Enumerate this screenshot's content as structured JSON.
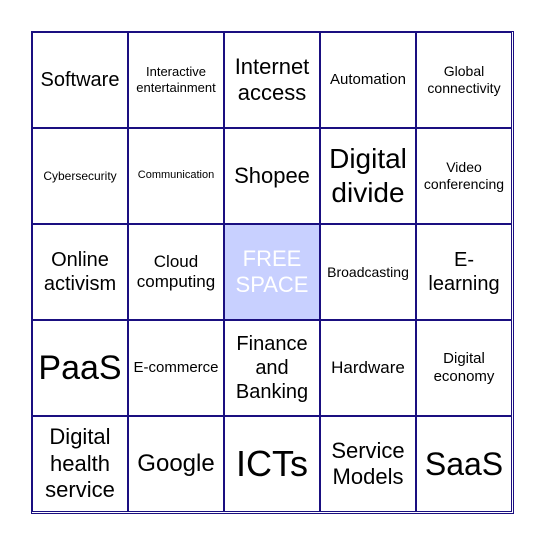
{
  "colors": {
    "border": "#1a0f80",
    "free_fill": "#c8d0ff",
    "free_text": "#ffffff"
  },
  "cells": [
    "Software",
    "Interactive entertainment",
    "Internet access",
    "Automation",
    "Global connectivity",
    "Cybersecurity",
    "Communication",
    "Shopee",
    "Digital divide",
    "Video conferencing",
    "Online activism",
    "Cloud computing",
    "FREE SPACE",
    "Broadcasting",
    "E-learning",
    "PaaS",
    "E-commerce",
    "Finance and Banking",
    "Hardware",
    "Digital economy",
    "Digital health service",
    "Google",
    "ICTs",
    "Service Models",
    "SaaS"
  ]
}
